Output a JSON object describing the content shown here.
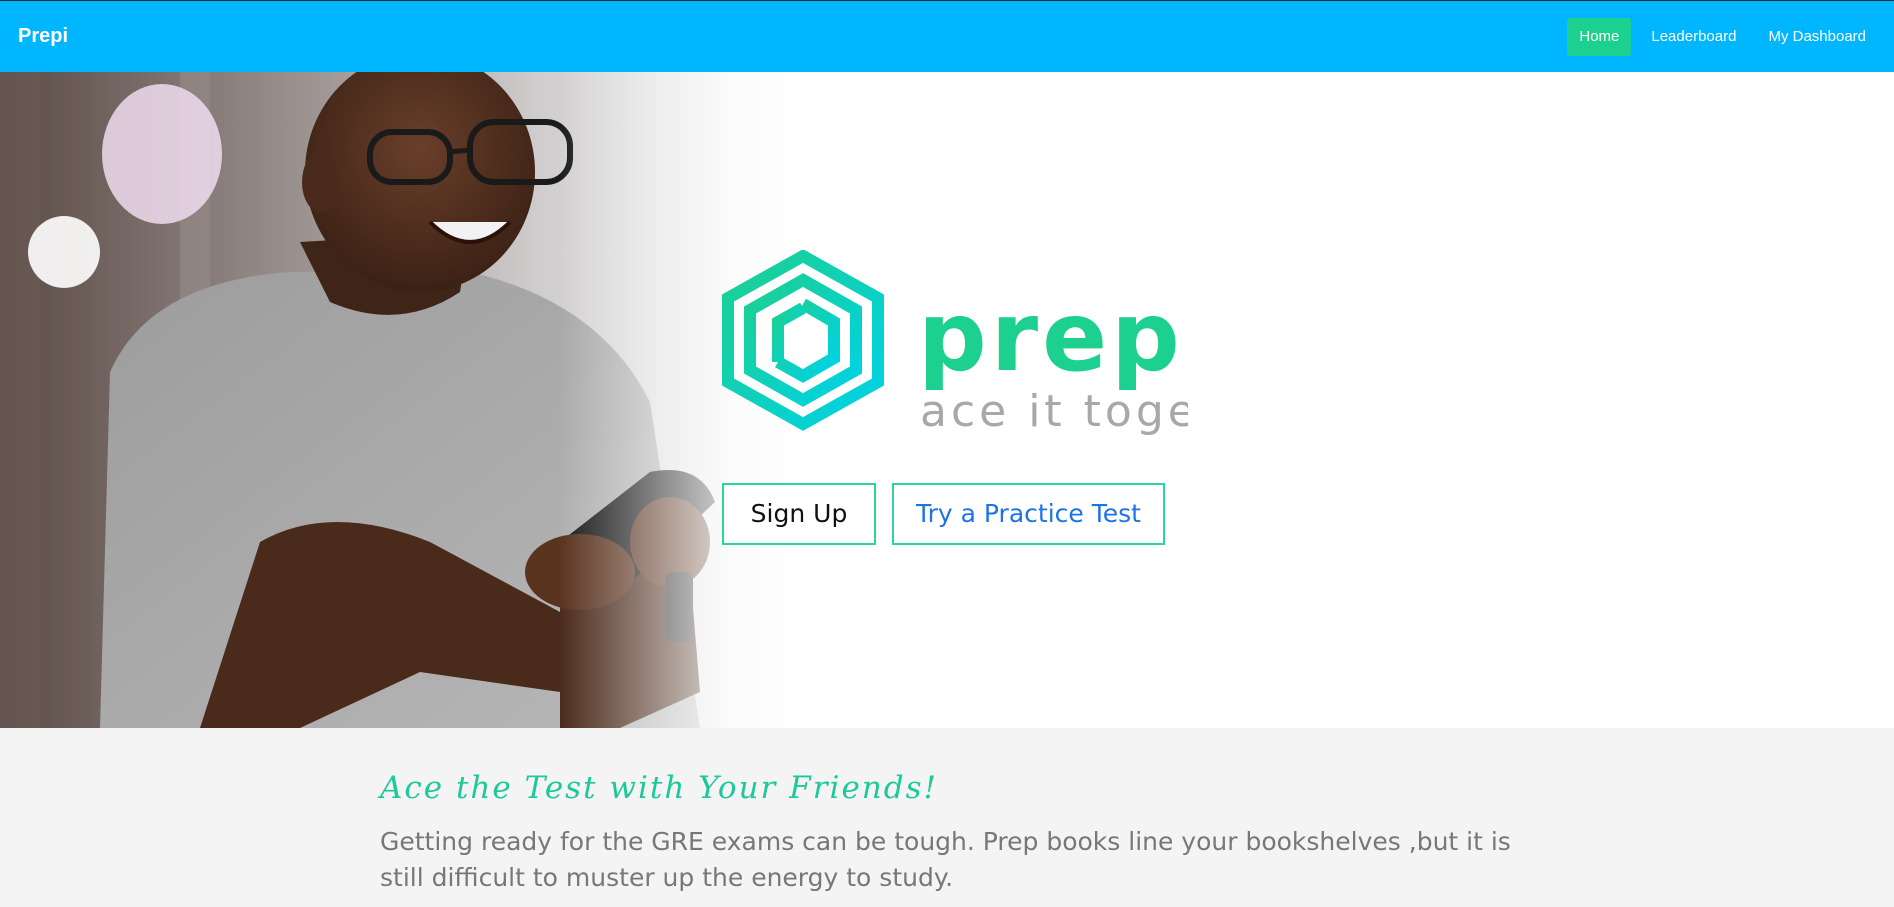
{
  "navbar": {
    "brand": "Prepi",
    "links": [
      {
        "label": "Home",
        "active": true
      },
      {
        "label": "Leaderboard",
        "active": false
      },
      {
        "label": "My Dashboard",
        "active": false
      }
    ],
    "bg_color": "#00b6ff",
    "active_color": "#1cd08f"
  },
  "hero": {
    "logo_wordmark": "prepi",
    "logo_tagline": "ace it together",
    "signup_label": "Sign Up",
    "practice_label": "Try a Practice Test",
    "accent_color": "#1cd08f"
  },
  "about": {
    "title": "Ace the Test with Your Friends!",
    "text": "Getting ready for the GRE exams can be tough. Prep books line your bookshelves ,but it is still difficult to muster up the energy to study."
  }
}
